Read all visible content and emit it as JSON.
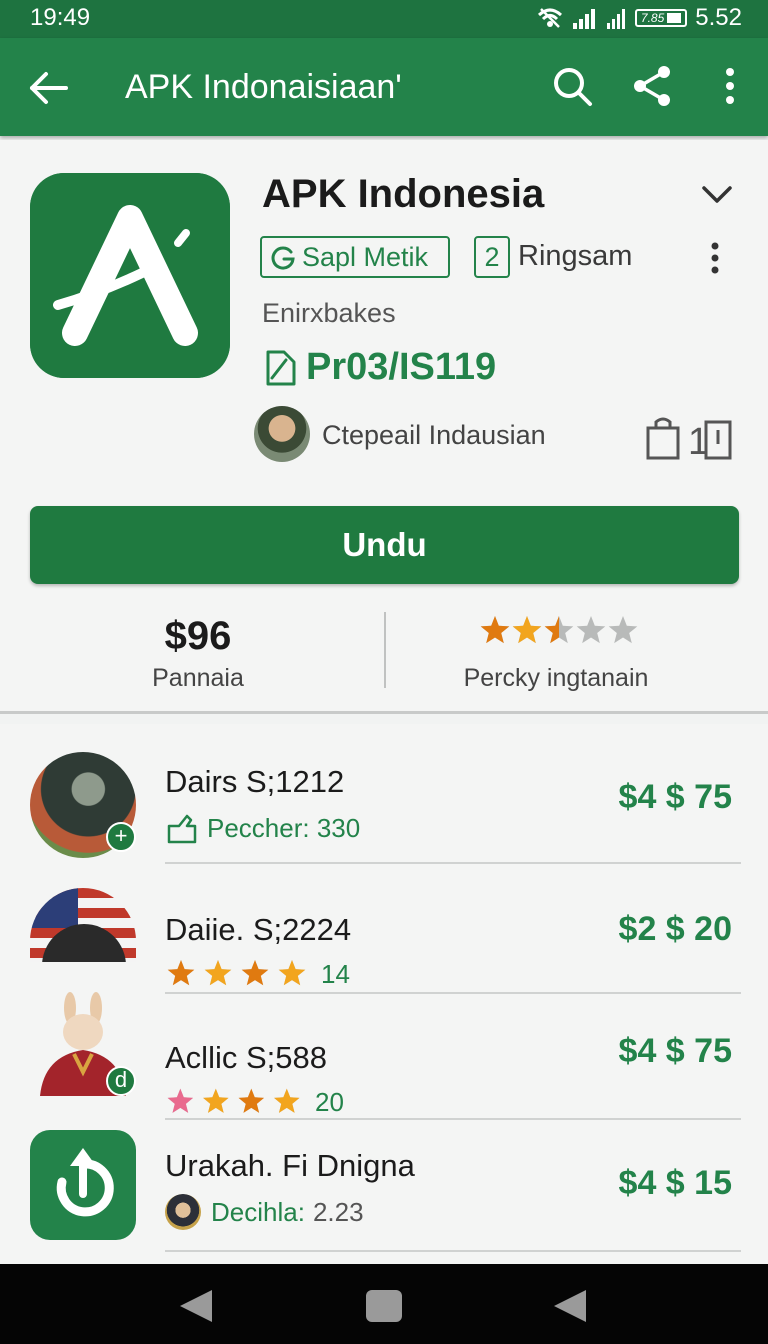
{
  "status_bar": {
    "time": "19:49",
    "battery": "7.85",
    "right_time": "5.52",
    "icons": [
      "wifi-off-icon",
      "signal-icon",
      "signal-icon",
      "battery-icon"
    ]
  },
  "app_bar": {
    "title": "APK Indonaisiaan'",
    "icons": [
      "back-arrow-icon",
      "search-icon",
      "share-icon",
      "more-vert-icon"
    ]
  },
  "app": {
    "name": "APK Indonesia",
    "tag_label": "Sapl Metik",
    "rank_number": "2",
    "rank_label": "Ringsam",
    "developer": "Enirxbakes",
    "price_code": "Pr03/IS119",
    "publisher": "Ctepeail Indausian",
    "bag_count": "1",
    "install_label": "Undu",
    "stat_price": "$96",
    "stat_price_label": "Pannaia",
    "stat_rating": 2.5,
    "stat_rating_label": "Percky ingtanain",
    "colors": {
      "primary": "#1f7a40",
      "accent": "#23834a",
      "star": "#e07a10"
    }
  },
  "list": [
    {
      "title": "Dairs  S;1212",
      "subtitle": "Peccher: 330",
      "sub_icon": "tag-icon",
      "price": "$4 $ 75",
      "badge": "+"
    },
    {
      "title": "Daiie. S;2224",
      "subtitle": "14",
      "rating": 4,
      "price": "$2 $ 20"
    },
    {
      "title": "Acllic S;588",
      "subtitle": "20",
      "rating": 4,
      "price": "$4 $ 75",
      "badge": "d"
    },
    {
      "title": "Urakah. Fi Dnigna",
      "subtitle_label": "Decihla:",
      "subtitle": "2.23",
      "price": "$4 $ 15"
    }
  ],
  "nav_bar": {
    "icons": [
      "nav-back-icon",
      "nav-home-icon",
      "nav-recent-icon"
    ]
  }
}
